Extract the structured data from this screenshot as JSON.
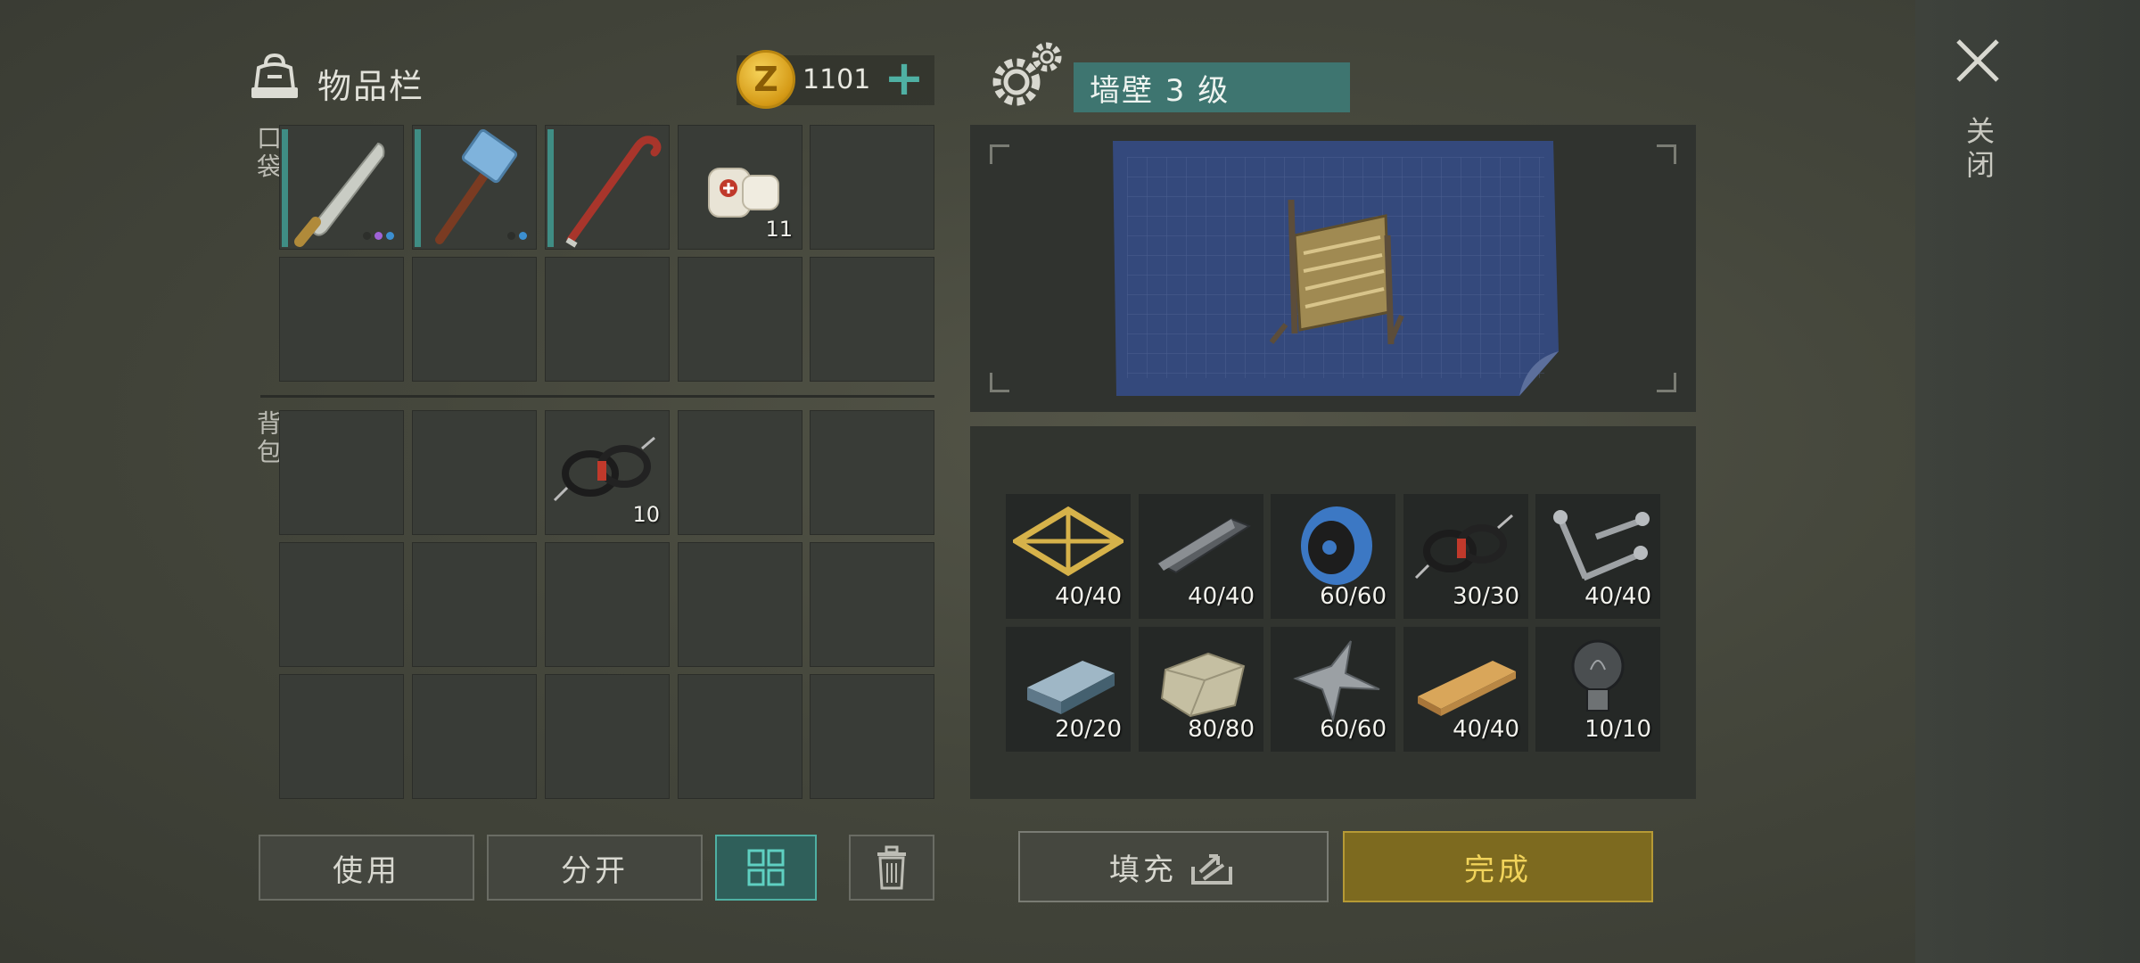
{
  "inventory": {
    "title": "物品栏",
    "coins": "1101",
    "pocket_label": "口袋",
    "backpack_label": "背包",
    "pocket_slots": [
      {
        "item": "machete-icon",
        "durability_bar": true,
        "dots": [
          "#2d2f2b",
          "#a063d8",
          "#3c8fd0"
        ]
      },
      {
        "item": "sledgehammer-icon",
        "durability_bar": true,
        "dots": [
          "#2d2f2b",
          "#3c8fd0"
        ]
      },
      {
        "item": "crowbar-icon",
        "durability_bar": true
      },
      {
        "item": "bandage-icon",
        "count": "11"
      },
      {
        "item": null
      }
    ],
    "backpack_rope": {
      "item": "rope-icon",
      "count": "10"
    }
  },
  "buttons": {
    "use": "使用",
    "split": "分开",
    "fill": "填充",
    "done": "完成"
  },
  "blueprint": {
    "title": "墙壁 3 级"
  },
  "requirements": [
    {
      "item": "wood-frame-icon",
      "count": "40/40"
    },
    {
      "item": "metal-bar-icon",
      "count": "40/40"
    },
    {
      "item": "wire-spool-icon",
      "count": "60/60"
    },
    {
      "item": "rope-icon",
      "count": "30/30"
    },
    {
      "item": "screws-icon",
      "count": "40/40"
    },
    {
      "item": "steel-ingot-icon",
      "count": "20/20"
    },
    {
      "item": "stone-icon",
      "count": "80/80"
    },
    {
      "item": "scrap-metal-icon",
      "count": "60/60"
    },
    {
      "item": "plank-icon",
      "count": "40/40"
    },
    {
      "item": "light-bulb-icon",
      "count": "10/10"
    }
  ],
  "close_label": "关闭",
  "colors": {
    "accent_teal": "#3e7570",
    "done_gold": "#7d6a1f"
  }
}
